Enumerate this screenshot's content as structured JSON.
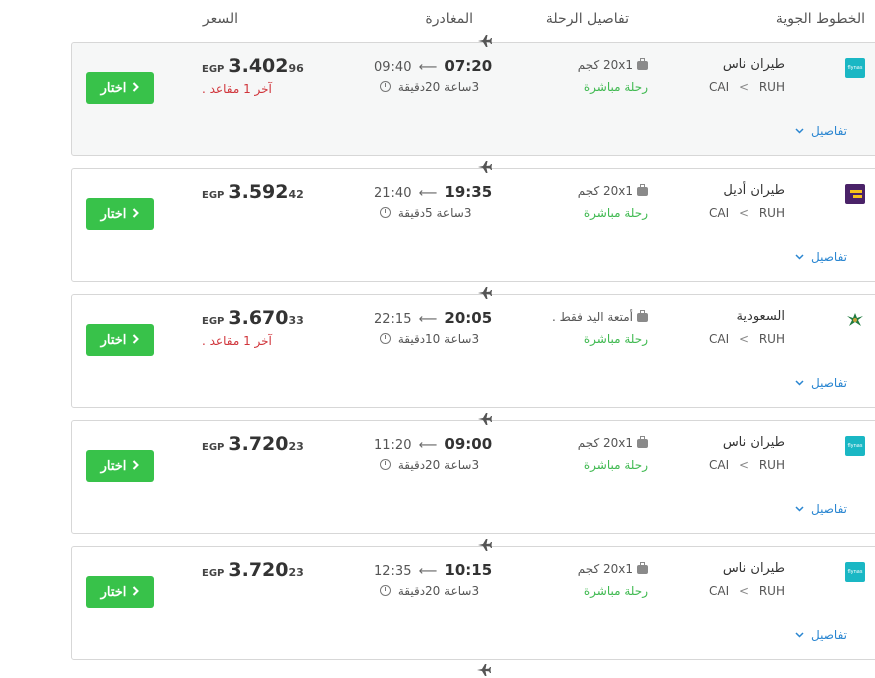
{
  "headers": {
    "airlines": "الخطوط الجوية",
    "flight_details": "تفاصيل الرحلة",
    "departure": "المغادرة",
    "price": "السعر"
  },
  "flights": [
    {
      "airline": "طيران ناس",
      "logo": "flynas-logo",
      "logo_text": "flynas",
      "from": "RUH",
      "to": "CAI",
      "route_sep": "<",
      "baggage": "20x1 كجم",
      "nonstop": "رحلة مباشرة",
      "dep": "07:20",
      "arr": "09:40",
      "arrow": "⟵",
      "duration": "3ساعة 20دقيقة",
      "currency": "EGP",
      "price_main": "3.402",
      "price_dec": "96",
      "seats": "آخر 1 مقاعد .",
      "details": "تفاصيل",
      "select": "اختار"
    },
    {
      "airline": "طيران أديل",
      "logo": "flyadeal-logo",
      "logo_text": "",
      "from": "RUH",
      "to": "CAI",
      "route_sep": "<",
      "baggage": "20x1 كجم",
      "nonstop": "رحلة مباشرة",
      "dep": "19:35",
      "arr": "21:40",
      "arrow": "⟵",
      "duration": "3ساعة 5دقيقة",
      "currency": "EGP",
      "price_main": "3.592",
      "price_dec": "42",
      "seats": "",
      "details": "تفاصيل",
      "select": "اختار"
    },
    {
      "airline": "السعودية",
      "logo": "saudia-logo",
      "logo_text": "",
      "from": "RUH",
      "to": "CAI",
      "route_sep": "<",
      "baggage": "أمتعة اليد فقط .",
      "nonstop": "رحلة مباشرة",
      "dep": "20:05",
      "arr": "22:15",
      "arrow": "⟵",
      "duration": "3ساعة 10دقيقة",
      "currency": "EGP",
      "price_main": "3.670",
      "price_dec": "33",
      "seats": "آخر 1 مقاعد .",
      "details": "تفاصيل",
      "select": "اختار"
    },
    {
      "airline": "طيران ناس",
      "logo": "flynas-logo",
      "logo_text": "flynas",
      "from": "RUH",
      "to": "CAI",
      "route_sep": "<",
      "baggage": "20x1 كجم",
      "nonstop": "رحلة مباشرة",
      "dep": "09:00",
      "arr": "11:20",
      "arrow": "⟵",
      "duration": "3ساعة 20دقيقة",
      "currency": "EGP",
      "price_main": "3.720",
      "price_dec": "23",
      "seats": "",
      "details": "تفاصيل",
      "select": "اختار"
    },
    {
      "airline": "طيران ناس",
      "logo": "flynas-logo",
      "logo_text": "flynas",
      "from": "RUH",
      "to": "CAI",
      "route_sep": "<",
      "baggage": "20x1 كجم",
      "nonstop": "رحلة مباشرة",
      "dep": "10:15",
      "arr": "12:35",
      "arrow": "⟵",
      "duration": "3ساعة 20دقيقة",
      "currency": "EGP",
      "price_main": "3.720",
      "price_dec": "23",
      "seats": "",
      "details": "تفاصيل",
      "select": "اختار"
    }
  ],
  "colors": {
    "select_button": "#38c24a",
    "nonstop": "#3fb950",
    "seats_warning": "#d0343a",
    "details_link": "#2a86d1",
    "flynas": "#1ab7c4",
    "flyadeal": "#4a2268",
    "saudia": "#1f7a3e"
  }
}
